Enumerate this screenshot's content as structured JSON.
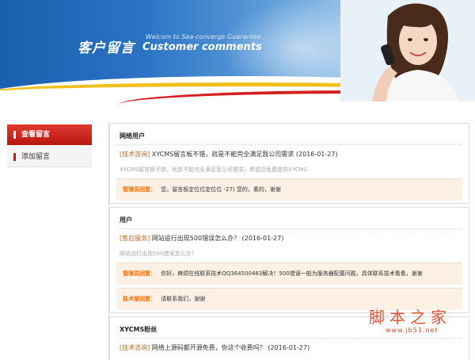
{
  "banner": {
    "title_cn": "客户留言",
    "title_en_small": "Welcom to Sea-converge Guarantee",
    "title_en": "Customer comments"
  },
  "sidebar": {
    "items": [
      {
        "label": "查看留言"
      },
      {
        "label": "添加留言"
      }
    ]
  },
  "comments": [
    {
      "user": "网络用户",
      "tag": "[技术咨询]",
      "title": "XYCMS留言板不错，就是不能完全满足我公司需求 (2016-01-27)",
      "body": "XYCMS留言板不错，就是不能完全满足我公司需求，希望还免费提供XYCMS",
      "replies": [
        {
          "who": "管理员回复：",
          "text": "您，留言板定位位定位位 -27) 您的，素的，谢谢"
        }
      ]
    },
    {
      "user": "用户",
      "tag": "[售后服务]",
      "title": "网站运行出现500错误怎么办？ (2016-01-27)",
      "body": "网站运行出现500错误怎么办？",
      "replies": [
        {
          "who": "管理员回复：",
          "text": "你好，麻烦在线联系技术QQ364500483解决！500错误一般为服务器配置问题，具体联系技术看看，谢谢"
        },
        {
          "who": "技术部回复：",
          "text": "请联系我们，谢谢"
        }
      ]
    },
    {
      "user": "XYCMS粉丝",
      "tag": "[技术咨询]",
      "title": "网络上源码都开源免费，你这个收费吗？ (2016-01-27)"
    }
  ],
  "watermark": {
    "cn": "脚本之家",
    "url": "www.jb51.net"
  },
  "colors": {
    "accent_red": "#c81a12",
    "reply_bg": "#fdf1e6",
    "reply_label": "#ff6a00"
  }
}
